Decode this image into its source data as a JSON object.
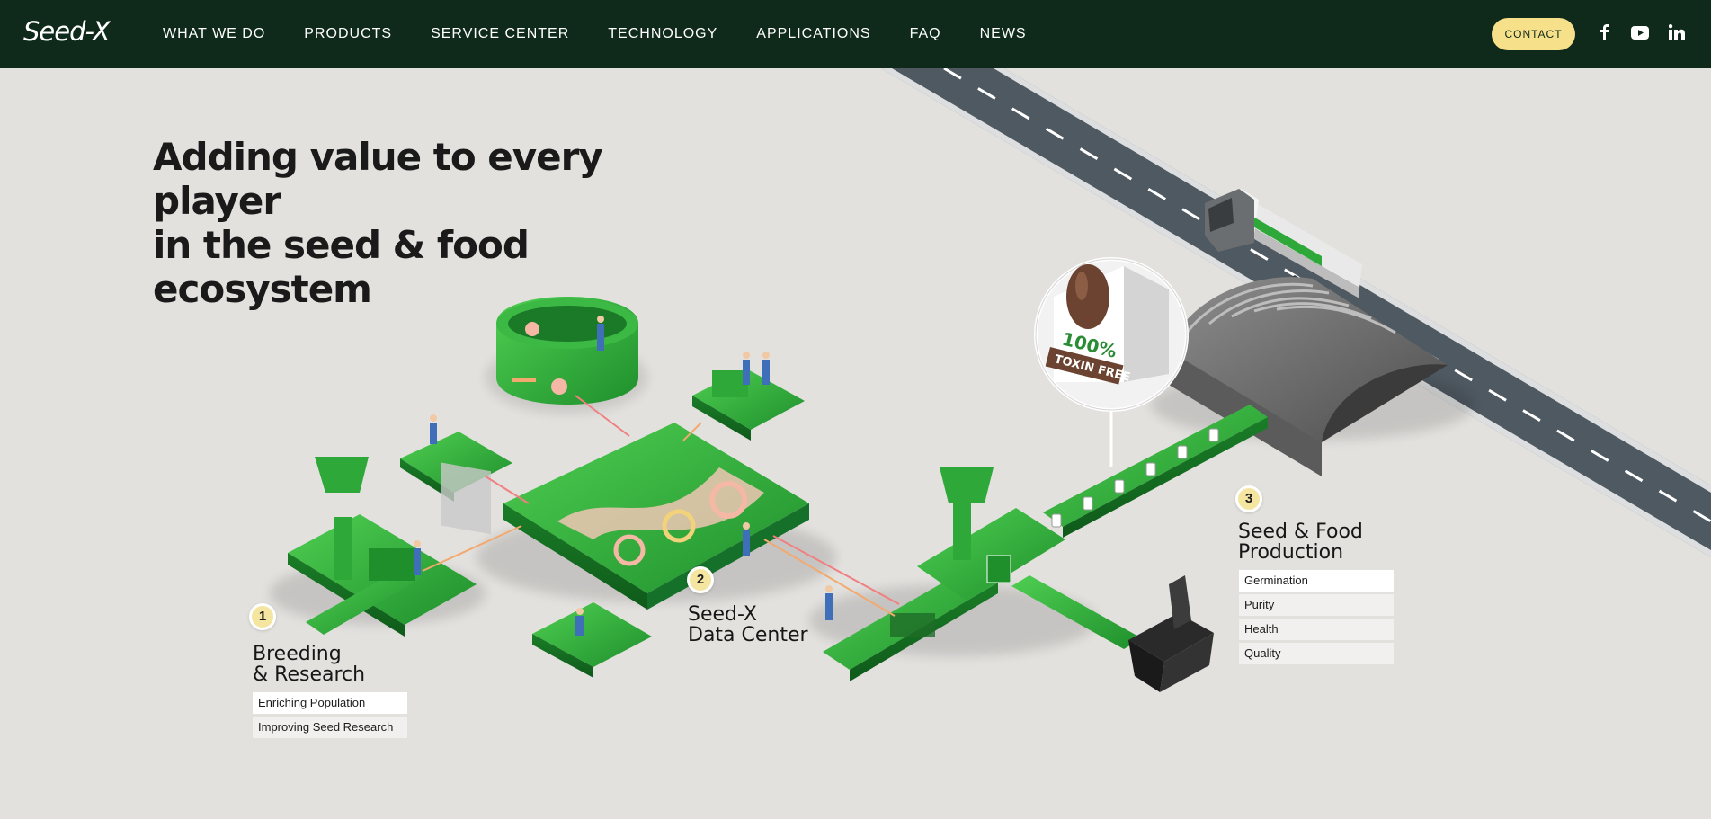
{
  "header": {
    "logo": "Seed-X",
    "nav": [
      "WHAT WE DO",
      "PRODUCTS",
      "SERVICE CENTER",
      "TECHNOLOGY",
      "APPLICATIONS",
      "FAQ",
      "NEWS"
    ],
    "contact_label": "CONTACT",
    "social": [
      "facebook-icon",
      "youtube-icon",
      "linkedin-icon"
    ]
  },
  "hero": {
    "title_lines": [
      "Adding value to every player",
      "in the seed & food",
      "ecosystem"
    ]
  },
  "stages": [
    {
      "number": "1",
      "title_lines": [
        "Breeding",
        "& Research"
      ],
      "tags": [
        "Enriching Population",
        "Improving Seed Research"
      ]
    },
    {
      "number": "2",
      "title_lines": [
        "Seed-X",
        "Data Center"
      ],
      "tags": []
    },
    {
      "number": "3",
      "title_lines": [
        "Seed & Food",
        "Production"
      ],
      "tags": [
        "Germination",
        "Purity",
        "Health",
        "Quality"
      ]
    }
  ],
  "label": {
    "line1": "100%",
    "line2": "TOXIN FREE"
  },
  "colors": {
    "header": "#0f2a1b",
    "accent": "#f7e08a",
    "green": "#2fa83a",
    "background": "#e3e1de"
  }
}
